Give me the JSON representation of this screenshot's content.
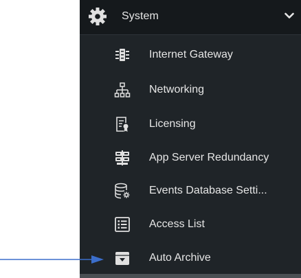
{
  "section": {
    "title": "System",
    "icon": "gear-icon",
    "expanded": true
  },
  "items": [
    {
      "label": "Internet Gateway",
      "icon": "internet-gateway-icon"
    },
    {
      "label": "Networking",
      "icon": "network-tree-icon"
    },
    {
      "label": "Licensing",
      "icon": "license-certificate-icon"
    },
    {
      "label": "App Server Redundancy",
      "icon": "server-redundancy-icon"
    },
    {
      "label": "Events Database Setti...",
      "icon": "database-settings-icon"
    },
    {
      "label": "Access List",
      "icon": "list-icon"
    },
    {
      "label": "Auto Archive",
      "icon": "archive-box-icon"
    }
  ],
  "colors": {
    "panel_bg": "#1f2428",
    "header_bg": "#15191c",
    "text": "#e6e6e6",
    "icon": "#e0e0e0",
    "annotation_arrow": "#3b6ecb"
  }
}
